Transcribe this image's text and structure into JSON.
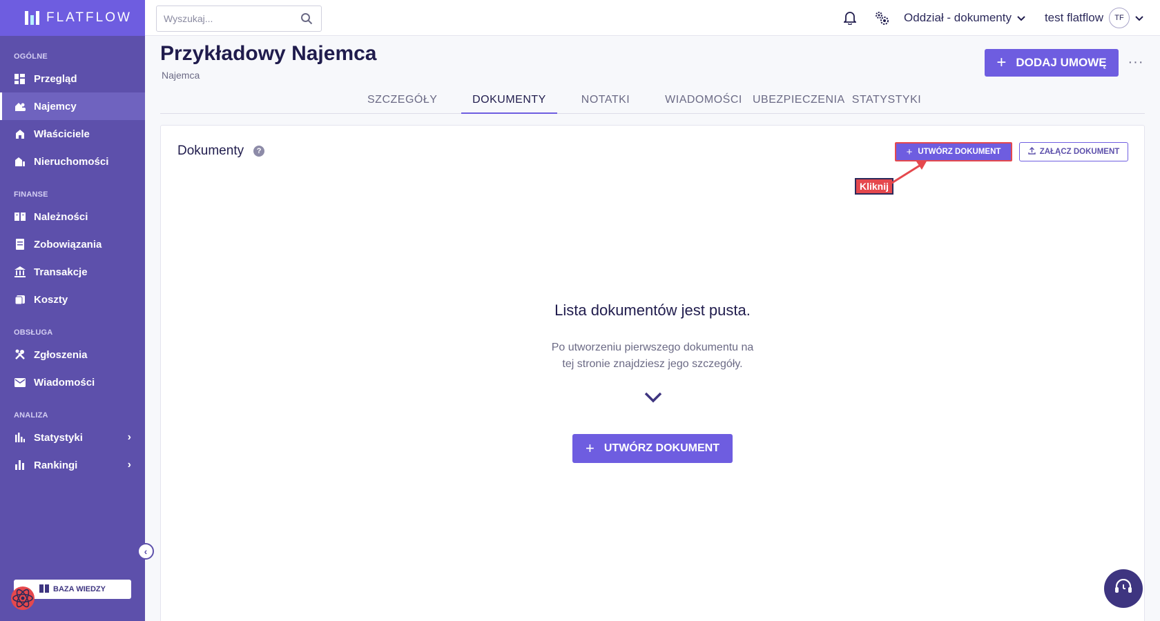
{
  "brand": {
    "name": "FLATFLOW"
  },
  "search": {
    "placeholder": "Wyszukaj..."
  },
  "topbar": {
    "branch": "Oddział - dokumenty",
    "user": "test flatflow",
    "avatar_initials": "TF"
  },
  "sidebar": {
    "sections": [
      {
        "title": "OGÓLNE",
        "items": [
          {
            "label": "Przegląd",
            "icon": "dashboard-icon"
          },
          {
            "label": "Najemcy",
            "icon": "tenants-icon",
            "active": true
          },
          {
            "label": "Właściciele",
            "icon": "owners-icon"
          },
          {
            "label": "Nieruchomości",
            "icon": "properties-icon"
          }
        ]
      },
      {
        "title": "FINANSE",
        "items": [
          {
            "label": "Należności",
            "icon": "receivables-icon"
          },
          {
            "label": "Zobowiązania",
            "icon": "liabilities-icon"
          },
          {
            "label": "Transakcje",
            "icon": "bank-icon"
          },
          {
            "label": "Koszty",
            "icon": "costs-icon"
          }
        ]
      },
      {
        "title": "OBSŁUGA",
        "items": [
          {
            "label": "Zgłoszenia",
            "icon": "tools-icon"
          },
          {
            "label": "Wiadomości",
            "icon": "mail-icon"
          }
        ]
      },
      {
        "title": "ANALIZA",
        "items": [
          {
            "label": "Statystyki",
            "icon": "stats-icon",
            "expandable": true
          },
          {
            "label": "Rankingi",
            "icon": "ranking-icon",
            "expandable": true
          }
        ]
      }
    ],
    "knowledge_base": "BAZA WIEDZY"
  },
  "header": {
    "title": "Przykładowy Najemca",
    "subtitle": "Najemca",
    "add_contract": "DODAJ UMOWĘ",
    "more": "···"
  },
  "tabs": [
    {
      "label": "SZCZEGÓŁY"
    },
    {
      "label": "DOKUMENTY",
      "active": true
    },
    {
      "label": "NOTATKI"
    },
    {
      "label": "WIADOMOŚCI"
    },
    {
      "label": "UBEZPIECZENIA"
    },
    {
      "label": "STATYSTYKI"
    }
  ],
  "documents": {
    "title": "Dokumenty",
    "create_button": "UTWÓRZ DOKUMENT",
    "attach_button": "ZAŁĄCZ DOKUMENT",
    "annotation": "Kliknij",
    "empty_title": "Lista dokumentów jest pusta.",
    "empty_desc_line1": "Po utworzeniu pierwszego dokumentu na",
    "empty_desc_line2": "tej stronie znajdziesz jego szczegóły.",
    "create_button_large": "UTWÓRZ DOKUMENT"
  },
  "colors": {
    "sidebar": "#5d50ab",
    "accent": "#6e5de0",
    "highlight": "#e5484d",
    "text": "#201c4d"
  }
}
